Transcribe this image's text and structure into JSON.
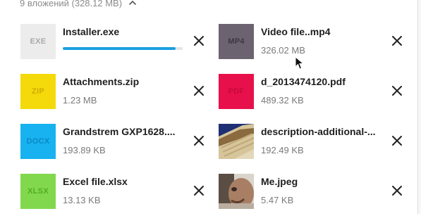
{
  "header": {
    "summary": "9 вложений (328.12 МВ)"
  },
  "attachments": [
    {
      "name": "Installer.exe",
      "ext": "EXE",
      "size": "",
      "thumb_type": "label",
      "bg": "#ececec",
      "fg": "#a9a9a9",
      "progress": 0.94
    },
    {
      "name": "Video file..mp4",
      "ext": "MP4",
      "size": "326.02 MB",
      "thumb_type": "label",
      "bg": "#6b6370",
      "fg": "#3e3742"
    },
    {
      "name": "Attachments.zip",
      "ext": "ZIP",
      "size": "1.23 MB",
      "thumb_type": "label",
      "bg": "#f4d90b",
      "fg": "#d0ad00"
    },
    {
      "name": "d_2013474120.pdf",
      "ext": "PDF",
      "size": "489.32 KB",
      "thumb_type": "label",
      "bg": "#e8104a",
      "fg": "#c50a3a"
    },
    {
      "name": "Grandstrem GXP1628....",
      "ext": "DOCX",
      "size": "193.89 KB",
      "thumb_type": "label",
      "bg": "#17b2ef",
      "fg": "#0b88c4"
    },
    {
      "name": "description-additional-...",
      "ext": "",
      "size": "192.49 KB",
      "thumb_type": "photo-roof",
      "bg": "#7a6a4a",
      "fg": ""
    },
    {
      "name": "Excel file.xlsx",
      "ext": "XLSX",
      "size": "13.13 KB",
      "thumb_type": "label",
      "bg": "#82d84c",
      "fg": "#4fae1d"
    },
    {
      "name": "Me.jpeg",
      "ext": "",
      "size": "5.47 KB",
      "thumb_type": "photo-face",
      "bg": "#7d7060",
      "fg": ""
    }
  ],
  "icons": {
    "chevron": "chevron-up-icon",
    "close": "close-icon",
    "cursor": "mouse-pointer-icon"
  }
}
